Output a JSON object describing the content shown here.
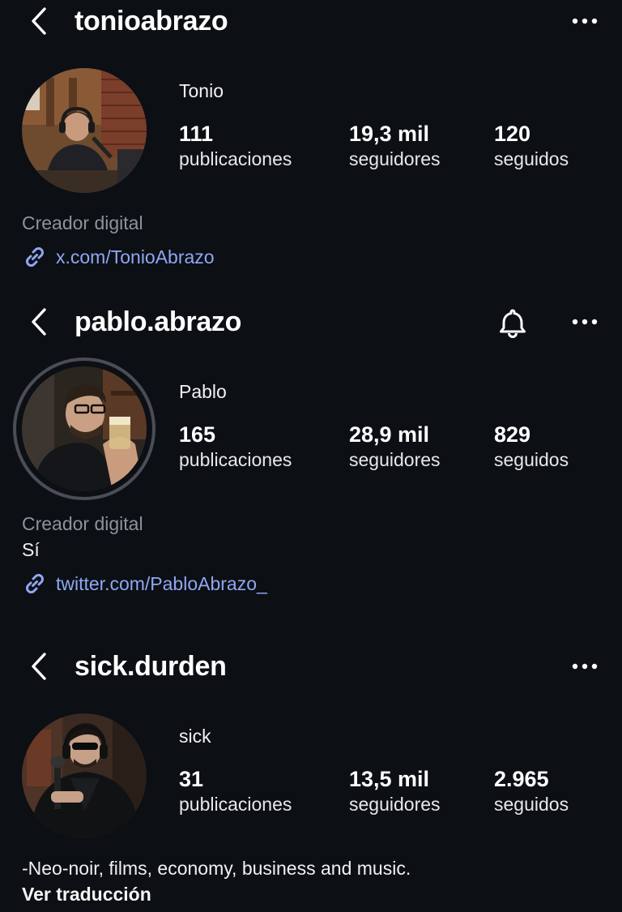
{
  "profiles": [
    {
      "username": "tonioabrazo",
      "full_name": "Tonio",
      "stats": [
        {
          "value": "111",
          "label": "publicaciones"
        },
        {
          "value": "19,3 mil",
          "label": "seguidores"
        },
        {
          "value": "120",
          "label": "seguidos"
        }
      ],
      "category": "Creador digital",
      "link": "x.com/TonioAbrazo"
    },
    {
      "username": "pablo.abrazo",
      "full_name": "Pablo",
      "stats": [
        {
          "value": "165",
          "label": "publicaciones"
        },
        {
          "value": "28,9 mil",
          "label": "seguidores"
        },
        {
          "value": "829",
          "label": "seguidos"
        }
      ],
      "category": "Creador digital",
      "bio": "Sí",
      "link": "twitter.com/PabloAbrazo_"
    },
    {
      "username": "sick.durden",
      "full_name": "sick",
      "stats": [
        {
          "value": "31",
          "label": "publicaciones"
        },
        {
          "value": "13,5 mil",
          "label": "seguidores"
        },
        {
          "value": "2.965",
          "label": "seguidos"
        }
      ],
      "bio": "-Neo-noir, films, economy, business and music.",
      "translate_label": "Ver traducción"
    }
  ],
  "icons": {
    "back": "chevron-left-icon",
    "more": "more-horizontal-icon",
    "bell": "bell-icon",
    "link": "link-icon"
  },
  "colors": {
    "background": "#0c0f14",
    "link": "#8fa7f2",
    "category": "#8e939b",
    "story_ring": "#4a4d55"
  }
}
